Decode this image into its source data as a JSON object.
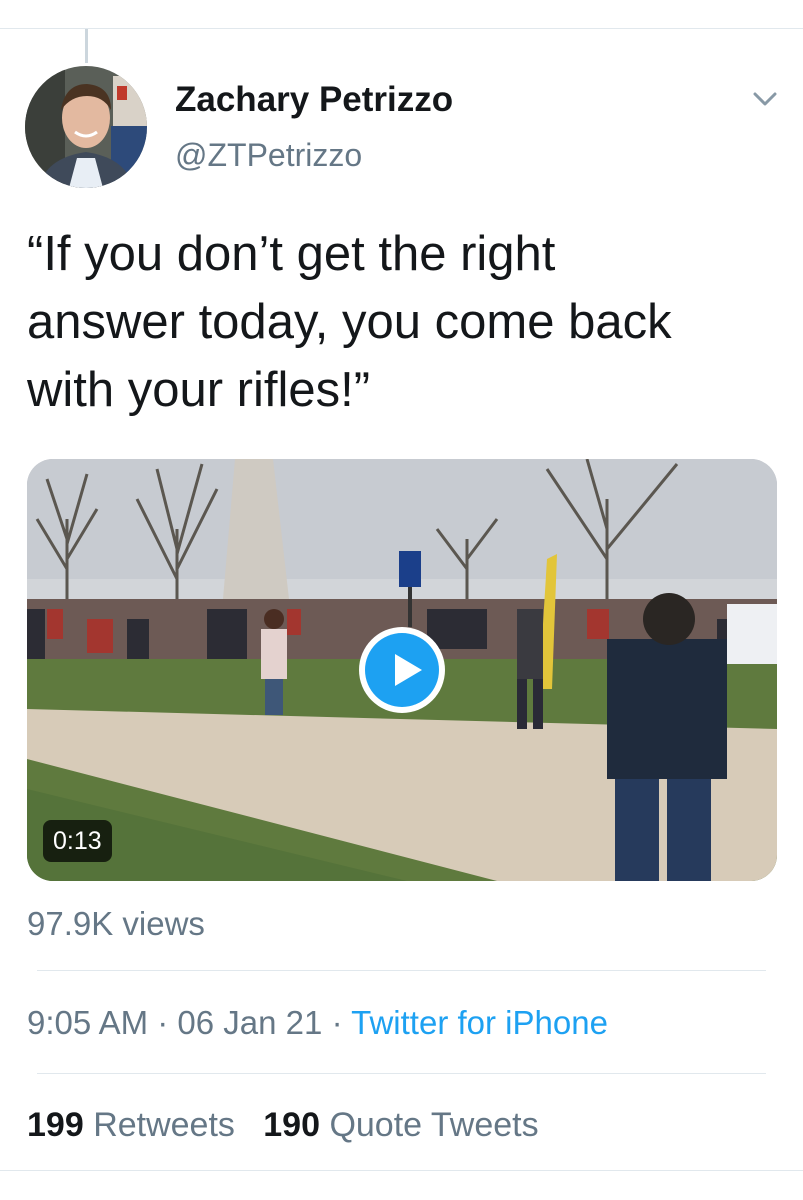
{
  "tweet": {
    "author": {
      "name": "Zachary Petrizzo",
      "handle": "@ZTPetrizzo"
    },
    "text": "“If you don’t get the right\nanswer today, you come back\nwith your rifles!”",
    "video": {
      "duration": "0:13"
    },
    "views": "97.9K views",
    "time": "9:05 AM",
    "date": "06 Jan 21",
    "separator": "·",
    "source": "Twitter for iPhone",
    "stats": {
      "retweets_count": "199",
      "retweets_label": "Retweets",
      "quotes_count": "190",
      "quotes_label": "Quote Tweets"
    }
  },
  "icons": {
    "menu": "chevron-down-icon",
    "play": "play-icon"
  },
  "colors": {
    "accent": "#1da1f2",
    "text": "#14171a",
    "secondary": "#657786",
    "divider": "#e1e8ed"
  }
}
